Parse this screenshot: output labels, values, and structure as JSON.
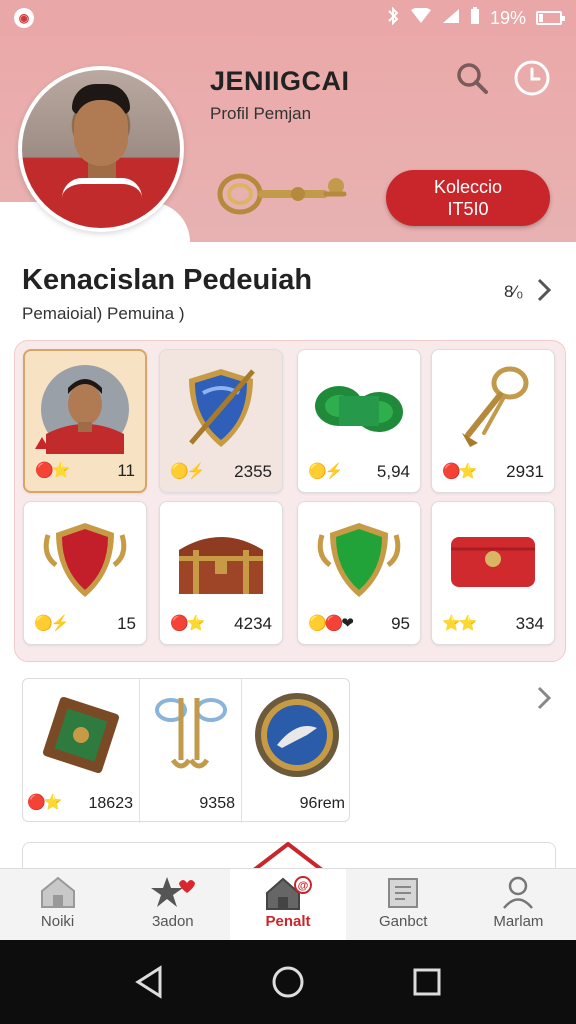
{
  "status_bar": {
    "battery_text": "19%",
    "battery_level": 0.19,
    "icons": [
      "app-notification-icon",
      "bluetooth-icon",
      "wifi-icon",
      "signal-icon",
      "battery-icon"
    ]
  },
  "header": {
    "title": "JENIIGCAI",
    "subtitle": "Profil Pemjan",
    "collection_button": {
      "line1": "Koleccio",
      "line2": "IT5I0"
    }
  },
  "section": {
    "title": "Kenacislan Pedeuiah",
    "subtitle": "Pemaioial) Pemuina )",
    "count": "8⁄₀"
  },
  "grid": [
    {
      "name": "player-portrait",
      "icons": "🔴⭐",
      "value": "11"
    },
    {
      "name": "blue-shield",
      "icons": "🟡⚡",
      "value": "2355"
    },
    {
      "name": "green-scroll",
      "icons": "🟡⚡",
      "value": "5,94"
    },
    {
      "name": "golden-key",
      "icons": "🔴⭐",
      "value": "2931"
    },
    {
      "name": "red-crest",
      "icons": "🟡⚡",
      "value": "15"
    },
    {
      "name": "treasure-chest",
      "icons": "🔴⭐",
      "value": "4234"
    },
    {
      "name": "green-shield",
      "icons": "🟡🔴❤",
      "value": "95"
    },
    {
      "name": "red-wallet",
      "icons": "⭐⭐",
      "value": "334"
    }
  ],
  "row2": [
    {
      "name": "green-book",
      "icons": "🔴⭐",
      "value": "18623"
    },
    {
      "name": "scissors-key",
      "icons": "",
      "value": "9358"
    },
    {
      "name": "blue-emblem",
      "icons": "",
      "value": "96rem"
    }
  ],
  "nav": [
    {
      "label": "Noiki",
      "icon": "home-icon"
    },
    {
      "label": "3adon",
      "icon": "star-heart-icon"
    },
    {
      "label": "Penalt",
      "icon": "home-badge-icon"
    },
    {
      "label": "Ganbct",
      "icon": "document-icon"
    },
    {
      "label": "Marlam",
      "icon": "profile-icon"
    }
  ],
  "colors": {
    "header_bg": "#eba9a9",
    "accent": "#c8262a",
    "grid_panel": "#f8eaea"
  }
}
